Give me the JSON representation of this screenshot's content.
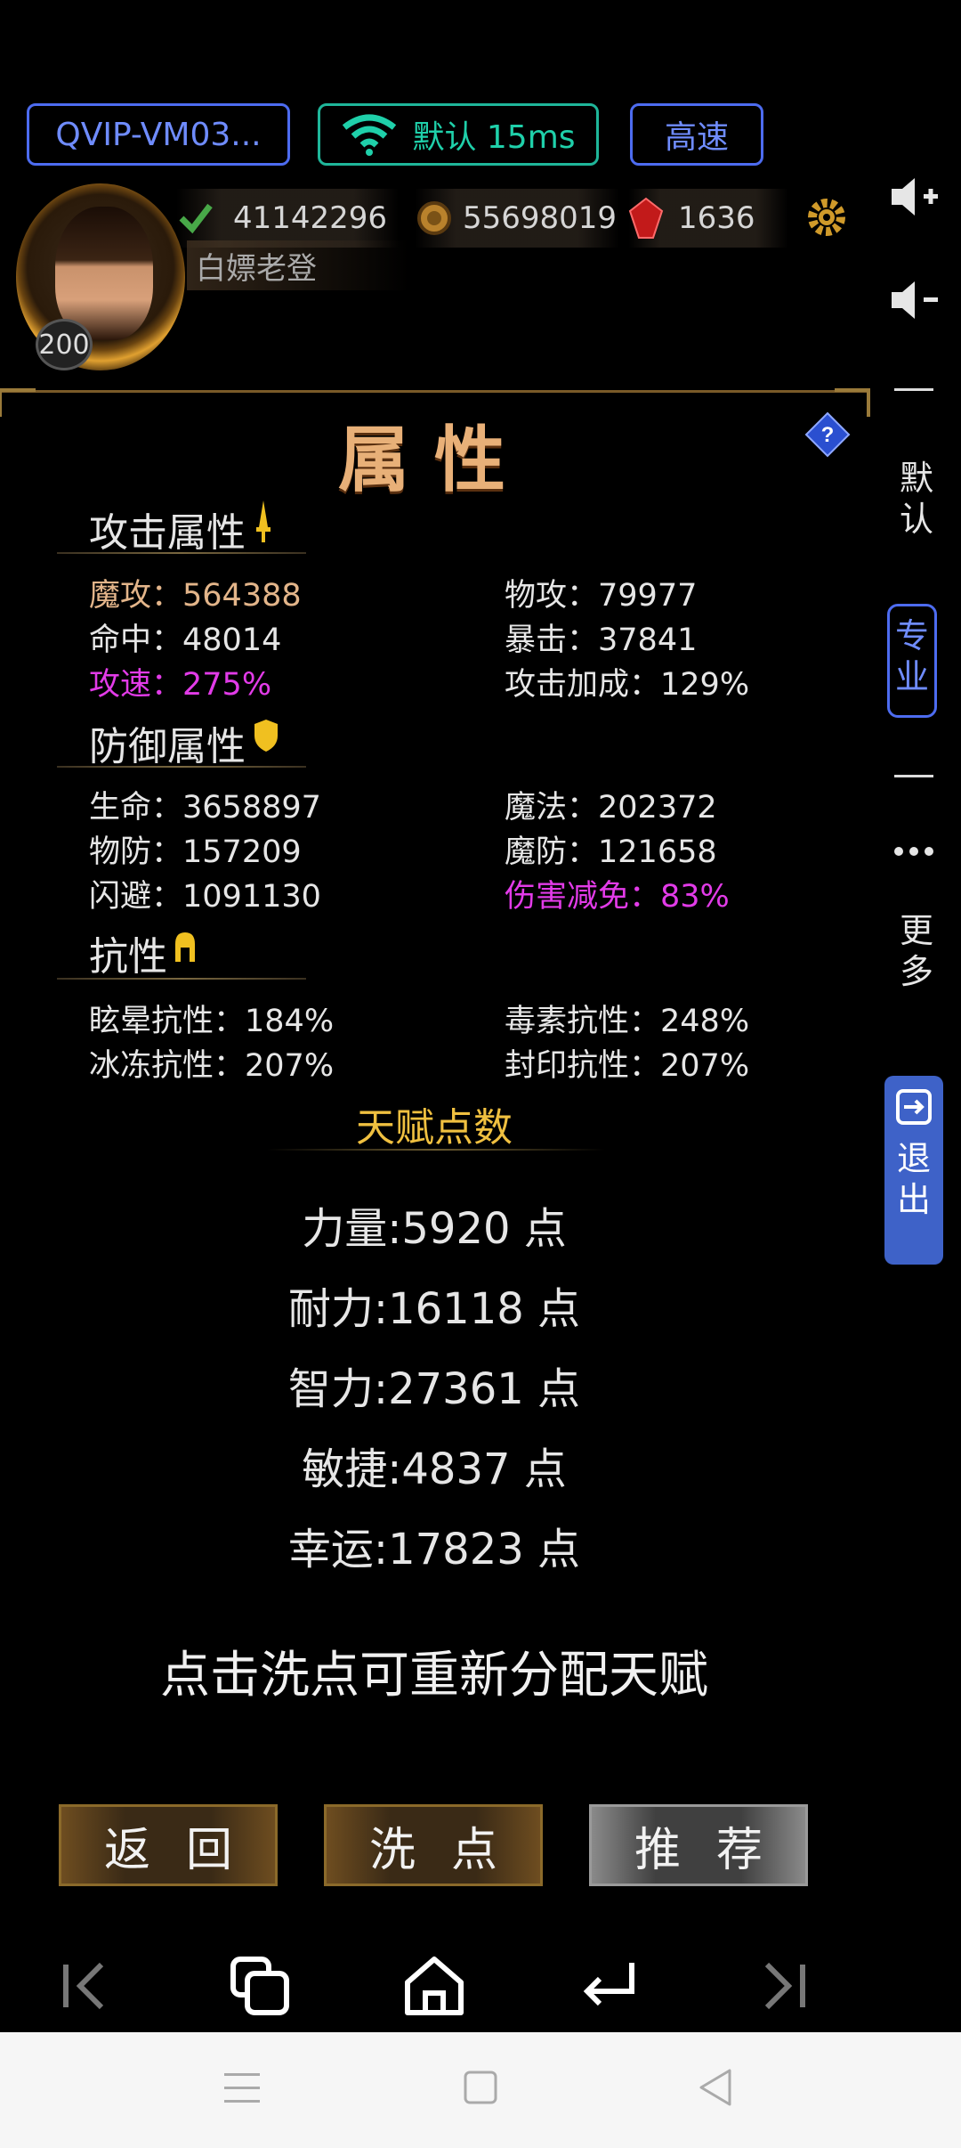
{
  "top": {
    "device_label": "QVIP-VM03...",
    "network_label": "默认 15ms",
    "speed_label": "高速"
  },
  "player": {
    "level": "200",
    "name": "白嫖老登",
    "currency_1": "41142296",
    "currency_2": "55698019",
    "currency_3": "1636"
  },
  "panel": {
    "title": "属性",
    "attack_section": "攻击属性",
    "attack": [
      {
        "label": "魔攻：",
        "value": "564388"
      },
      {
        "label": "物攻：",
        "value": "79977"
      },
      {
        "label": "命中：",
        "value": "48014"
      },
      {
        "label": "暴击：",
        "value": "37841"
      },
      {
        "label": "攻速：",
        "value": "275%"
      },
      {
        "label": "攻击加成：",
        "value": "129%"
      }
    ],
    "defense_section": "防御属性",
    "defense": [
      {
        "label": "生命：",
        "value": "3658897"
      },
      {
        "label": "魔法：",
        "value": "202372"
      },
      {
        "label": "物防：",
        "value": "157209"
      },
      {
        "label": "魔防：",
        "value": "121658"
      },
      {
        "label": "闪避：",
        "value": "1091130"
      },
      {
        "label": "伤害减免：",
        "value": "83%"
      }
    ],
    "resist_section": "抗性",
    "resist": [
      {
        "label": "眩晕抗性：",
        "value": "184%"
      },
      {
        "label": "毒素抗性：",
        "value": "248%"
      },
      {
        "label": "冰冻抗性：",
        "value": "207%"
      },
      {
        "label": "封印抗性：",
        "value": "207%"
      }
    ],
    "talent_title": "天赋点数",
    "talents": [
      "力量:5920 点",
      "耐力:16118 点",
      "智力:27361 点",
      "敏捷:4837 点",
      "幸运:17823 点"
    ],
    "hint": "点击洗点可重新分配天赋",
    "buttons": {
      "back": "返回",
      "reset": "洗点",
      "recommend": "推荐"
    }
  },
  "sidebar": {
    "default_label": "默认",
    "pro_label": "专业",
    "more_label": "更多",
    "exit_label": "退出"
  },
  "colors": {
    "accent_blue": "#4d6cf0",
    "accent_green": "#1fb69a",
    "highlight_magenta": "#e23be8",
    "gold": "#e3b58a"
  }
}
